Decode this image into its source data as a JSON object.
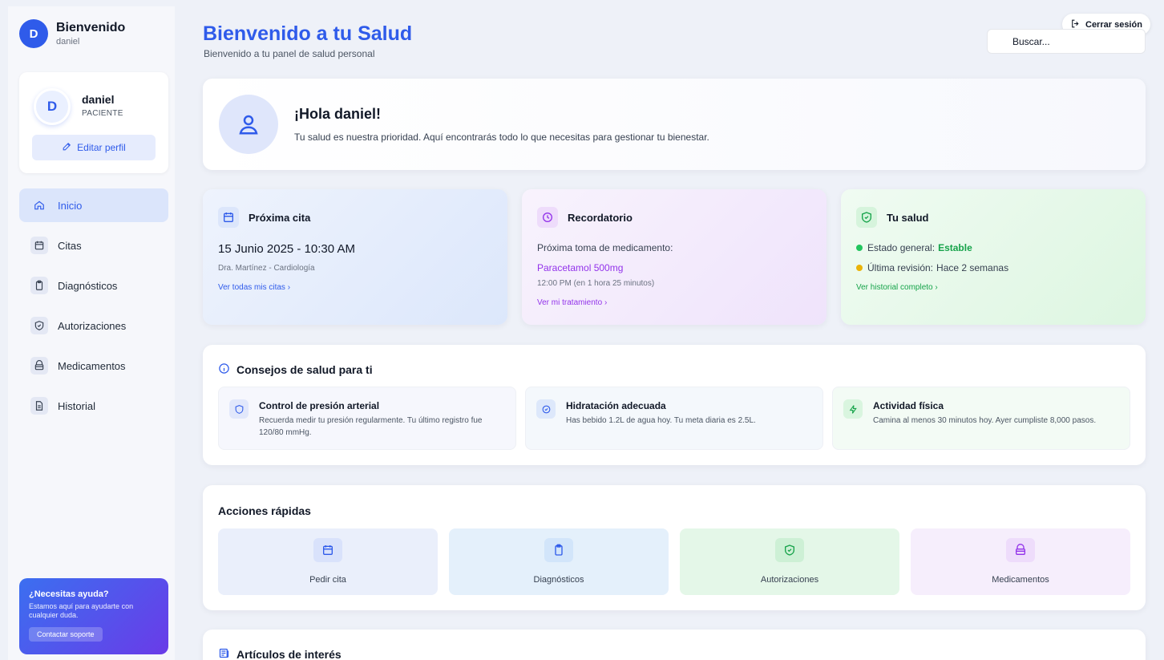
{
  "sidebar": {
    "welcome_title": "Bienvenido",
    "welcome_user": "daniel",
    "avatar_initial": "D",
    "profile": {
      "initial": "D",
      "name": "daniel",
      "role": "PACIENTE",
      "edit_label": "Editar perfil"
    },
    "nav": [
      {
        "label": "Inicio",
        "icon": "home-icon",
        "active": true
      },
      {
        "label": "Citas",
        "icon": "calendar-icon"
      },
      {
        "label": "Diagnósticos",
        "icon": "clipboard-icon"
      },
      {
        "label": "Autorizaciones",
        "icon": "shield-icon"
      },
      {
        "label": "Medicamentos",
        "icon": "pill-box-icon"
      },
      {
        "label": "Historial",
        "icon": "file-text-icon"
      }
    ],
    "help": {
      "title": "¿Necesitas ayuda?",
      "text": "Estamos aquí para ayudarte con cualquier duda.",
      "button": "Contactar soporte"
    }
  },
  "header": {
    "title": "Bienvenido a tu Salud",
    "subtitle": "Bienvenido a tu panel de salud personal",
    "logout": "Cerrar sesión",
    "search_placeholder": "Buscar..."
  },
  "hero": {
    "title": "¡Hola daniel!",
    "text": "Tu salud es nuestra prioridad. Aquí encontrarás todo lo que necesitas para gestionar tu bienestar."
  },
  "cards": {
    "cita": {
      "title": "Próxima cita",
      "date": "15 Junio 2025 - 10:30 AM",
      "doctor": "Dra. Martínez - Cardiología",
      "link": "Ver todas mis citas"
    },
    "reco": {
      "title": "Recordatorio",
      "line1": "Próxima toma de medicamento:",
      "medicine": "Paracetamol 500mg",
      "time": "12:00 PM (en 1 hora 25 minutos)",
      "link": "Ver mi tratamiento"
    },
    "salud": {
      "title": "Tu salud",
      "estado_label": "Estado general:",
      "estado_value": "Estable",
      "revision_label": "Última revisión:",
      "revision_value": "Hace 2 semanas",
      "link": "Ver historial completo"
    }
  },
  "consejos": {
    "title": "Consejos de salud para ti",
    "tips": [
      {
        "title": "Control de presión arterial",
        "text": "Recuerda medir tu presión regularmente. Tu último registro fue 120/80 mmHg."
      },
      {
        "title": "Hidratación adecuada",
        "text": "Has bebido 1.2L de agua hoy. Tu meta diaria es 2.5L."
      },
      {
        "title": "Actividad física",
        "text": "Camina al menos 30 minutos hoy. Ayer cumpliste 8,000 pasos."
      }
    ]
  },
  "acciones": {
    "title": "Acciones rápidas",
    "items": [
      {
        "label": "Pedir cita"
      },
      {
        "label": "Diagnósticos"
      },
      {
        "label": "Autorizaciones"
      },
      {
        "label": "Medicamentos"
      }
    ]
  },
  "articulos": {
    "title": "Artículos de interés"
  },
  "colors": {
    "primary": "#2f5bea",
    "purple": "#9333ea",
    "green": "#16a34a",
    "amber": "#eab308"
  }
}
